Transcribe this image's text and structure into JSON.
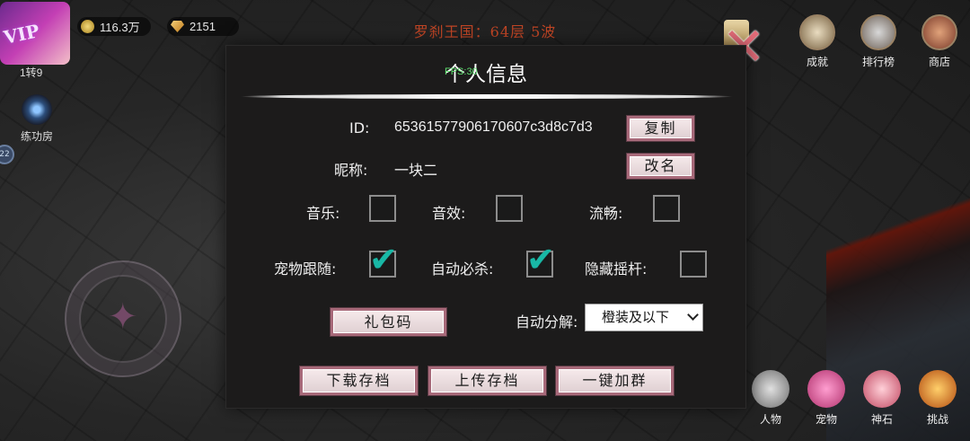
{
  "hud": {
    "vip_badge": "VIP",
    "rank_label": "1转9",
    "coins": "116.3万",
    "gems": "2151",
    "side_button_label": "练功房",
    "side_badge": "22",
    "stage_title": "罗刹王国：64层 5波"
  },
  "top_menu": [
    {
      "label": "成就",
      "icon": "achievement-icon"
    },
    {
      "label": "排行榜",
      "icon": "leaderboard-icon"
    },
    {
      "label": "商店",
      "icon": "shop-icon"
    }
  ],
  "bottom_menu": [
    {
      "label": "人物",
      "icon": "character-icon"
    },
    {
      "label": "宠物",
      "icon": "pet-icon"
    },
    {
      "label": "神石",
      "icon": "divine-stone-icon"
    },
    {
      "label": "挑战",
      "icon": "challenge-icon"
    }
  ],
  "dialog": {
    "title": "个人信息",
    "fps_overlay": "FPS:30",
    "id_label": "ID:",
    "id_value": "65361577906170607c3d8c7d3",
    "copy_button": "复制",
    "nickname_label": "昵称:",
    "nickname_value": "一块二",
    "rename_button": "改名",
    "settings": {
      "music": {
        "label": "音乐:",
        "checked": false
      },
      "sound": {
        "label": "音效:",
        "checked": false
      },
      "smooth": {
        "label": "流畅:",
        "checked": false
      },
      "pet_follow": {
        "label": "宠物跟随:",
        "checked": true
      },
      "auto_ultimate": {
        "label": "自动必杀:",
        "checked": true
      },
      "hide_joystick": {
        "label": "隐藏摇杆:",
        "checked": false
      }
    },
    "gift_code_button": "礼包码",
    "auto_decompose_label": "自动分解:",
    "auto_decompose_value": "橙装及以下",
    "download_save_button": "下载存档",
    "upload_save_button": "上传存档",
    "join_group_button": "一键加群"
  },
  "colors": {
    "stage_title": "#c04525",
    "check": "#19b8a6",
    "close": "#e26b78",
    "button_border": "#a86a7a"
  }
}
